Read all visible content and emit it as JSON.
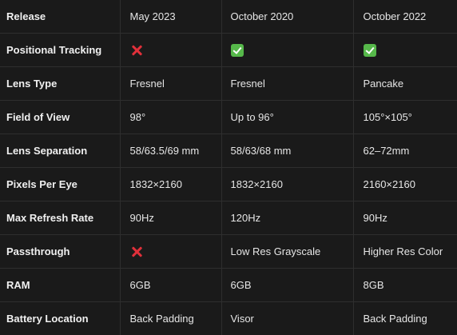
{
  "rows": [
    {
      "label": "Release",
      "cells": [
        {
          "text": "May 2023"
        },
        {
          "text": "October 2020"
        },
        {
          "text": "October 2022"
        }
      ]
    },
    {
      "label": "Positional Tracking",
      "cells": [
        {
          "icon": "cross-mark-icon"
        },
        {
          "icon": "check-mark-icon"
        },
        {
          "icon": "check-mark-icon"
        }
      ]
    },
    {
      "label": "Lens Type",
      "cells": [
        {
          "text": "Fresnel"
        },
        {
          "text": "Fresnel"
        },
        {
          "text": "Pancake"
        }
      ]
    },
    {
      "label": "Field of View",
      "cells": [
        {
          "text": "98°"
        },
        {
          "text": "Up to 96°"
        },
        {
          "text": "105°×105°"
        }
      ]
    },
    {
      "label": "Lens Separation",
      "cells": [
        {
          "text": "58/63.5/69 mm"
        },
        {
          "text": "58/63/68 mm"
        },
        {
          "text": "62–72mm"
        }
      ]
    },
    {
      "label": "Pixels Per Eye",
      "cells": [
        {
          "text": "1832×2160"
        },
        {
          "text": "1832×2160"
        },
        {
          "text": "2160×2160"
        }
      ]
    },
    {
      "label": "Max Refresh Rate",
      "cells": [
        {
          "text": "90Hz"
        },
        {
          "text": "120Hz"
        },
        {
          "text": "90Hz"
        }
      ]
    },
    {
      "label": "Passthrough",
      "cells": [
        {
          "icon": "cross-mark-icon"
        },
        {
          "text": "Low Res Grayscale"
        },
        {
          "text": "Higher Res Color"
        }
      ]
    },
    {
      "label": "RAM",
      "cells": [
        {
          "text": "6GB"
        },
        {
          "text": "6GB"
        },
        {
          "text": "8GB"
        }
      ]
    },
    {
      "label": "Battery Location",
      "cells": [
        {
          "text": "Back Padding"
        },
        {
          "text": "Visor"
        },
        {
          "text": "Back Padding"
        }
      ]
    }
  ],
  "colors": {
    "background": "#1a1a1a",
    "text": "#e6e6e6",
    "grid": "#2e2e2e",
    "cross": "#e0303a",
    "check": "#56b84a"
  }
}
